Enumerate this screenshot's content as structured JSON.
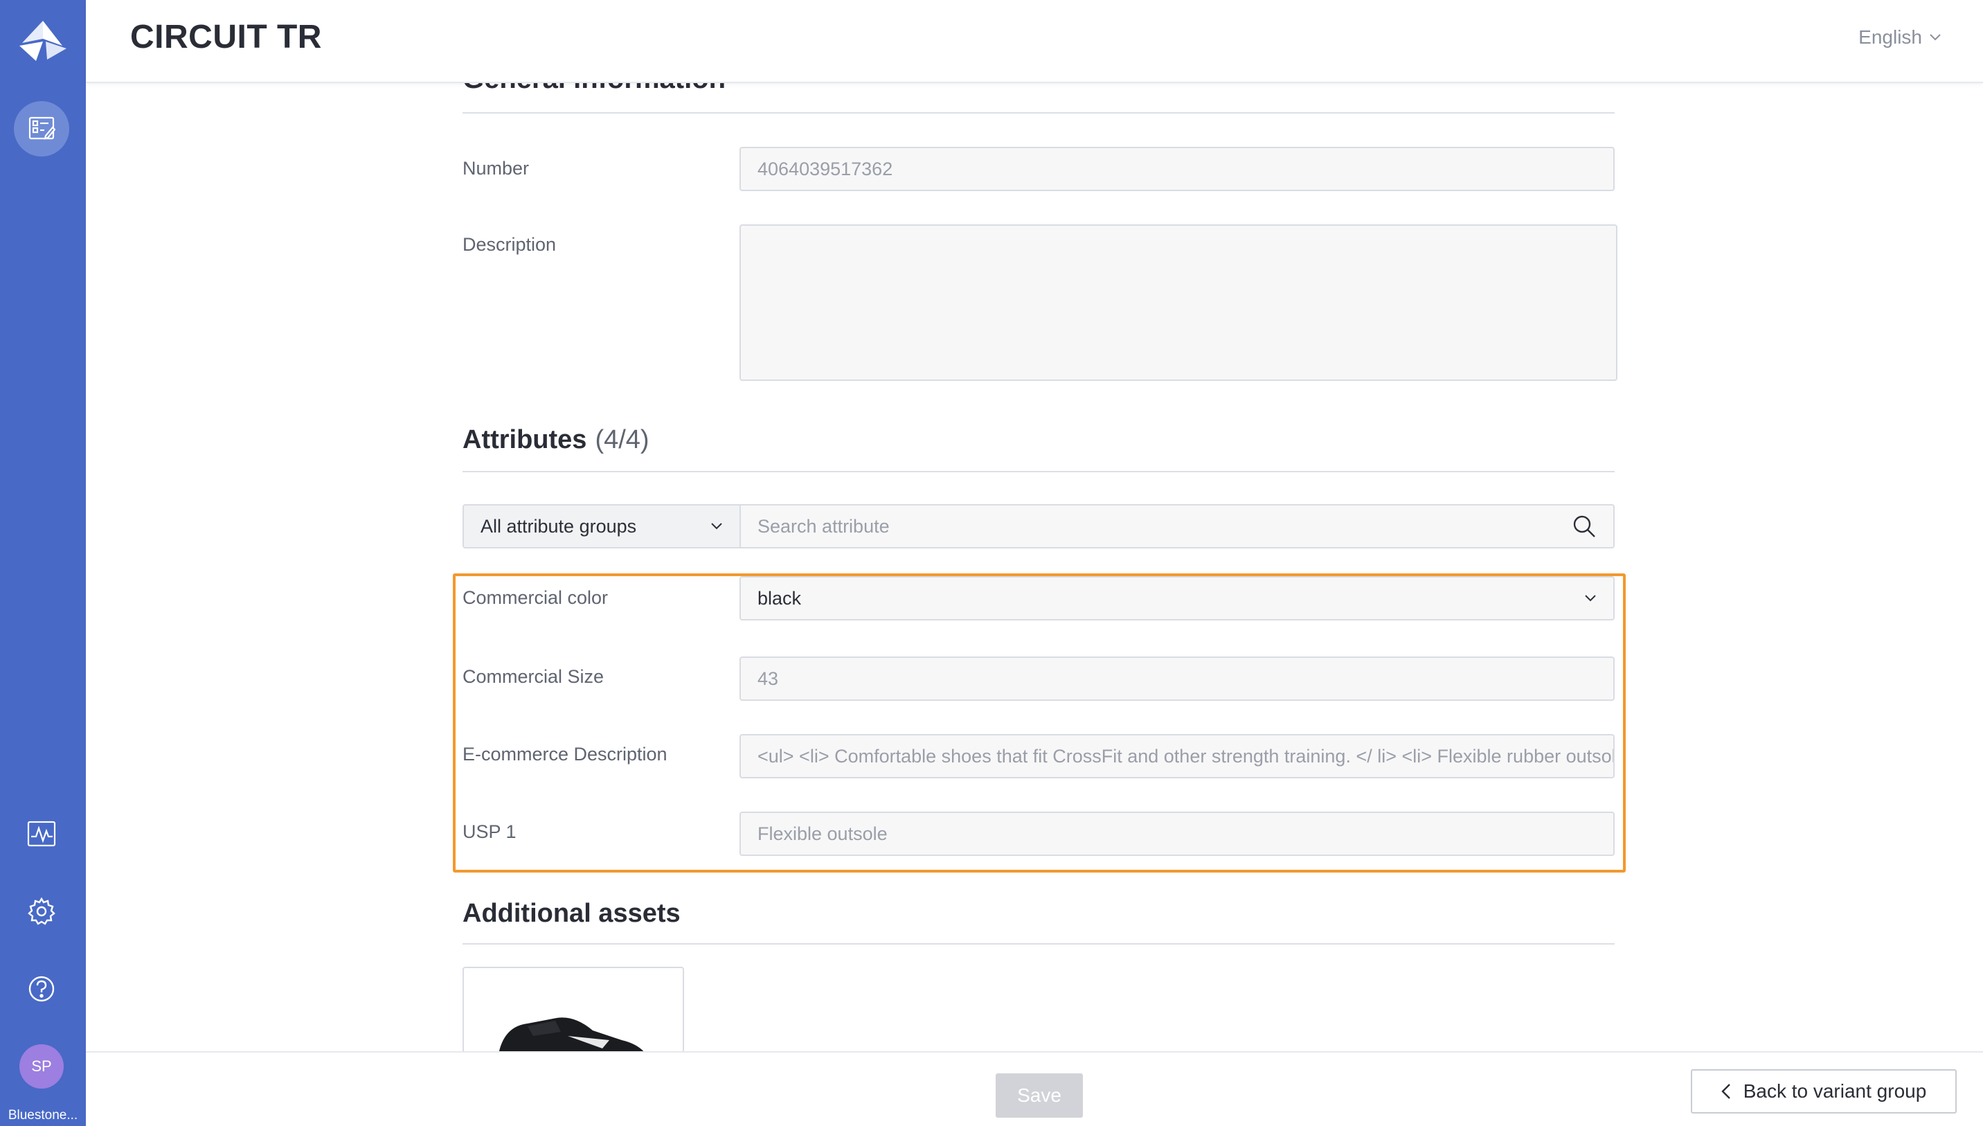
{
  "app": {
    "title": "CIRCUIT TR",
    "language": "English",
    "org_name": "Bluestone...",
    "user_initials": "SP"
  },
  "sidebar": {
    "icons": [
      "logo-icon",
      "products-icon",
      "activity-icon",
      "gear-icon",
      "help-icon"
    ]
  },
  "general": {
    "title": "General information",
    "number_label": "Number",
    "number_value": "4064039517362",
    "description_label": "Description",
    "description_value": ""
  },
  "attributes": {
    "title": "Attributes",
    "count": "(4/4)",
    "group_filter": "All attribute groups",
    "search_placeholder": "Search attribute",
    "rows": [
      {
        "label": "Commercial color",
        "value": "black"
      },
      {
        "label": "Commercial Size",
        "value": "43"
      },
      {
        "label": "E-commerce Description",
        "value": "<ul> <li> Comfortable shoes that fit CrossFit and other strength training. </ li> <li> Flexible rubber outsole </li> </ul>"
      },
      {
        "label": "USP 1",
        "value": "Flexible outsole"
      }
    ]
  },
  "assets": {
    "title": "Additional assets"
  },
  "footer": {
    "save_label": "Save",
    "back_label": "Back to variant group"
  },
  "colors": {
    "sidebar": "#4869c6",
    "highlight": "#f2992e",
    "avatar": "#9c7fe0"
  }
}
